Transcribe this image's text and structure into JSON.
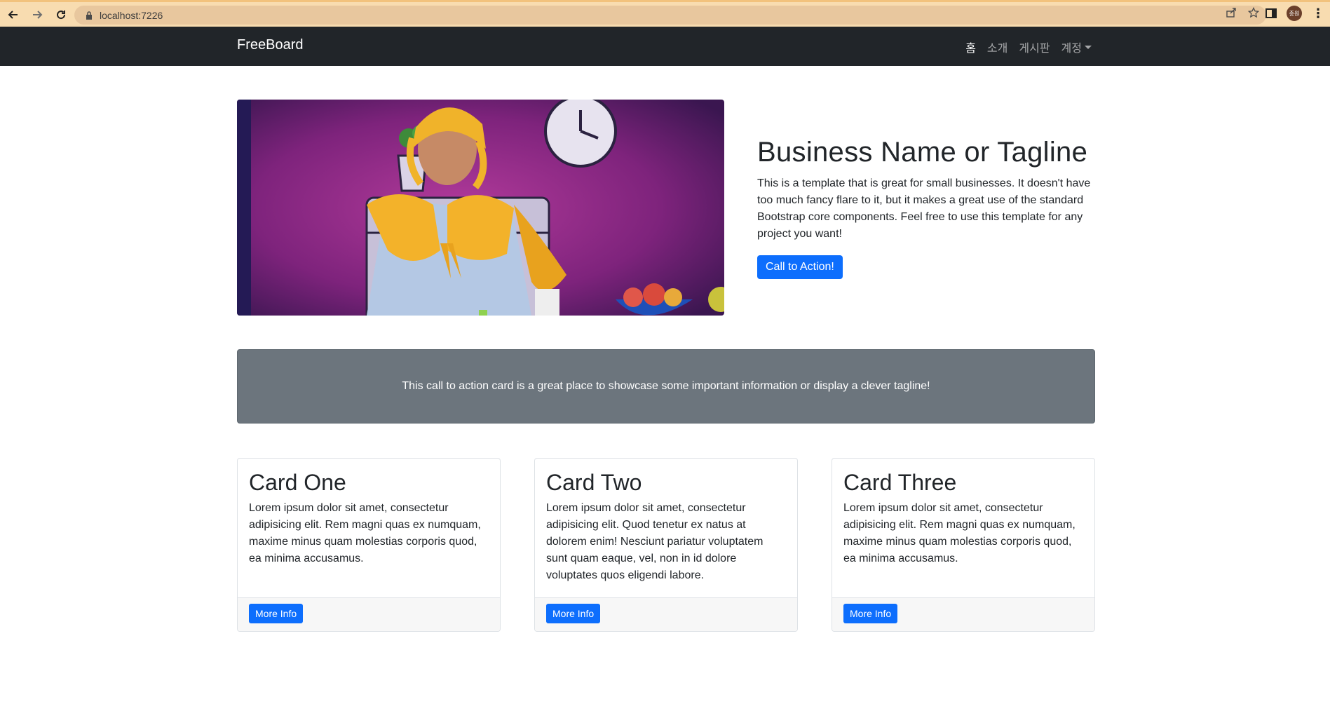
{
  "browser": {
    "url": "localhost:7226",
    "profile_initials": "종원",
    "accent_color": "#f8dcb0"
  },
  "navbar": {
    "brand": "FreeBoard",
    "links": [
      {
        "label": "홈",
        "active": true
      },
      {
        "label": "소개",
        "active": false
      },
      {
        "label": "게시판",
        "active": false
      },
      {
        "label": "계정",
        "active": false,
        "dropdown": true
      }
    ]
  },
  "hero": {
    "title": "Business Name or Tagline",
    "description": "This is a template that is great for small businesses. It doesn't have too much fancy flare to it, but it makes a great use of the standard Bootstrap core components. Feel free to use this template for any project you want!",
    "button": "Call to Action!"
  },
  "cta_card": {
    "text": "This call to action card is a great place to showcase some important information or display a clever tagline!"
  },
  "cards": [
    {
      "title": "Card One",
      "text": "Lorem ipsum dolor sit amet, consectetur adipisicing elit. Rem magni quas ex numquam, maxime minus quam molestias corporis quod, ea minima accusamus.",
      "button": "More Info"
    },
    {
      "title": "Card Two",
      "text": "Lorem ipsum dolor sit amet, consectetur adipisicing elit. Quod tenetur ex natus at dolorem enim! Nesciunt pariatur voluptatem sunt quam eaque, vel, non in id dolore voluptates quos eligendi labore.",
      "button": "More Info"
    },
    {
      "title": "Card Three",
      "text": "Lorem ipsum dolor sit amet, consectetur adipisicing elit. Rem magni quas ex numquam, maxime minus quam molestias corporis quod, ea minima accusamus.",
      "button": "More Info"
    }
  ],
  "colors": {
    "primary": "#0d6efd",
    "dark": "#212529",
    "secondary": "#6c757d"
  }
}
